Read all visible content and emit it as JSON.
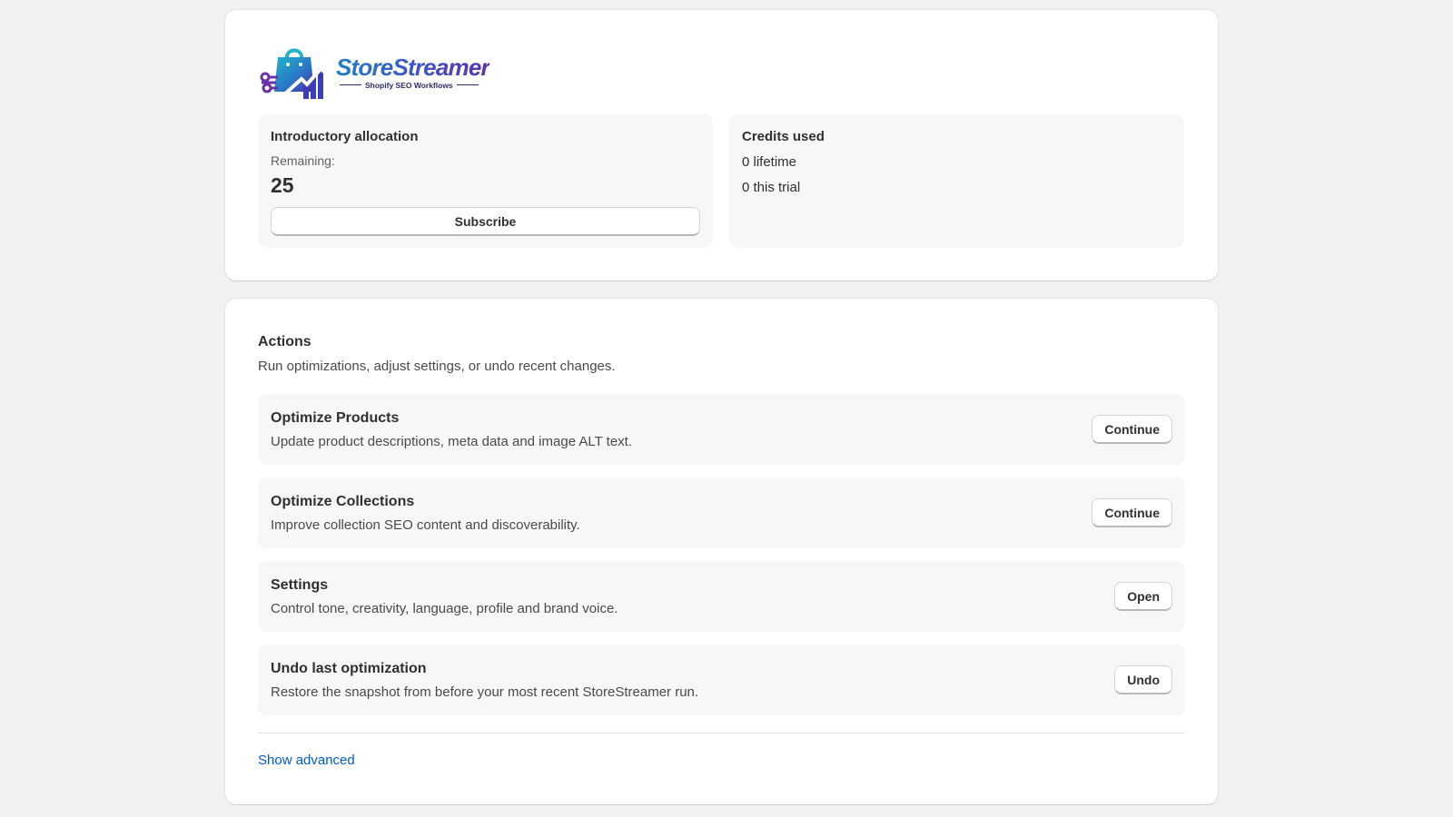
{
  "brand": {
    "name_part1": "Store",
    "name_part2": "Streamer",
    "tagline": "Shopify SEO Workflows",
    "colors": {
      "blue": "#1e7fc9",
      "purple": "#5a2fb0",
      "navy": "#2b2b6b"
    }
  },
  "allocation": {
    "title": "Introductory allocation",
    "remaining_label": "Remaining:",
    "remaining_value": "25",
    "subscribe_label": "Subscribe"
  },
  "credits": {
    "title": "Credits used",
    "lifetime": "0 lifetime",
    "trial": "0 this trial"
  },
  "actions": {
    "title": "Actions",
    "description": "Run optimizations, adjust settings, or undo recent changes.",
    "items": [
      {
        "title": "Optimize Products",
        "description": "Update product descriptions, meta data and image ALT text.",
        "button": "Continue"
      },
      {
        "title": "Optimize Collections",
        "description": "Improve collection SEO content and discoverability.",
        "button": "Continue"
      },
      {
        "title": "Settings",
        "description": "Control tone, creativity, language, profile and brand voice.",
        "button": "Open"
      },
      {
        "title": "Undo last optimization",
        "description": "Restore the snapshot from before your most recent StoreStreamer run.",
        "button": "Undo"
      }
    ],
    "advanced_link": "Show advanced"
  },
  "theme": {
    "link_color": "#005bd3",
    "page_bg": "#f1f1f1"
  }
}
